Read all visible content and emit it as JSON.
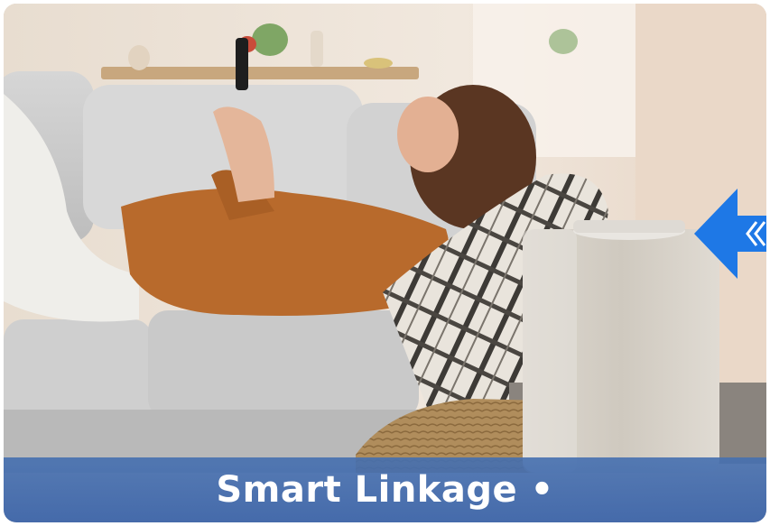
{
  "banner": {
    "caption": "Smart Linkage •"
  },
  "colors": {
    "caption_bar": "#4670B0",
    "arrow": "#1E78E6",
    "caption_text": "#FFFFFF"
  },
  "icons": {
    "pointer": "arrow-left-icon",
    "chevrons": "double-chevron-left-icon"
  }
}
